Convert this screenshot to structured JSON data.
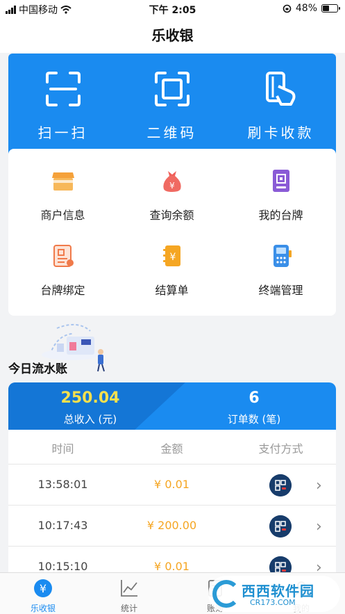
{
  "status_bar": {
    "carrier": "中国移动",
    "time": "下午 2:05",
    "battery": "48%"
  },
  "nav": {
    "title": "乐收银"
  },
  "hero": {
    "items": [
      {
        "label": "扫一扫",
        "icon": "scan-icon"
      },
      {
        "label": "二维码",
        "icon": "qr-frame-icon"
      },
      {
        "label": "刷卡收款",
        "icon": "card-swipe-icon"
      }
    ]
  },
  "grid": {
    "items": [
      {
        "label": "商户信息",
        "icon": "shop-icon",
        "color": "#f5a13a"
      },
      {
        "label": "查询余额",
        "icon": "money-bag-icon",
        "color": "#f0605a"
      },
      {
        "label": "我的台牌",
        "icon": "table-card-icon",
        "color": "#8a5bd6"
      },
      {
        "label": "台牌绑定",
        "icon": "bind-document-icon",
        "color": "#f07a4a"
      },
      {
        "label": "结算单",
        "icon": "settlement-icon",
        "color": "#f5a623"
      },
      {
        "label": "终端管理",
        "icon": "pos-terminal-icon",
        "color": "#3a8fe8"
      }
    ]
  },
  "today": {
    "title": "今日流水账"
  },
  "summary": {
    "total_income_value": "250.04",
    "total_income_label": "总收入 (元)",
    "order_count_value": "6",
    "order_count_label": "订单数 (笔)",
    "value_color": "#f4e04d"
  },
  "table": {
    "headers": [
      "时间",
      "金额",
      "支付方式"
    ],
    "rows": [
      {
        "time": "13:58:01",
        "amount": "¥ 0.01"
      },
      {
        "time": "10:17:43",
        "amount": "¥ 200.00"
      },
      {
        "time": "10:15:10",
        "amount": "¥ 0.01"
      }
    ]
  },
  "tabs": [
    {
      "label": "乐收银",
      "icon": "yuan-icon",
      "active": true
    },
    {
      "label": "统计",
      "icon": "chart-icon",
      "active": false
    },
    {
      "label": "账簿",
      "icon": "ledger-icon",
      "active": false
    },
    {
      "label": "我的",
      "icon": "profile-icon",
      "active": false
    }
  ],
  "watermark": {
    "title": "西西软件园",
    "subtitle": "CR173.COM"
  }
}
